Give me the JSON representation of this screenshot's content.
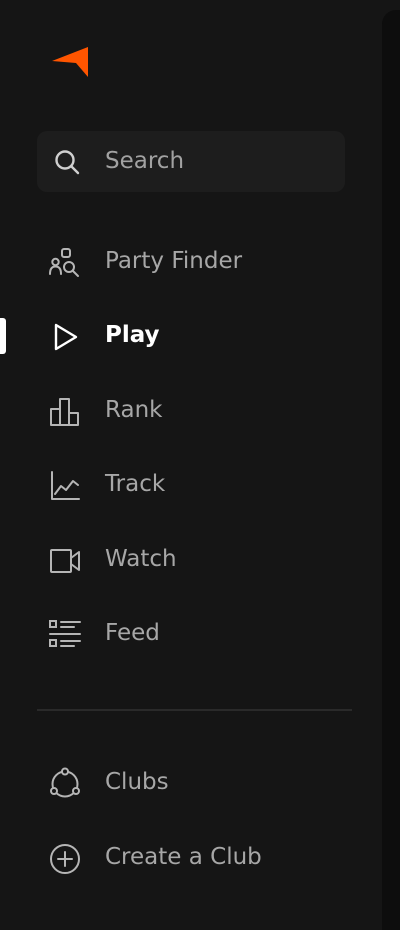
{
  "sidebar": {
    "search": {
      "placeholder": "Search",
      "icon": "search-icon"
    },
    "nav": [
      {
        "label": "Party Finder",
        "icon": "party-finder-icon",
        "active": false
      },
      {
        "label": "Play",
        "icon": "play-icon",
        "active": true
      },
      {
        "label": "Rank",
        "icon": "rank-icon",
        "active": false
      },
      {
        "label": "Track",
        "icon": "track-icon",
        "active": false
      },
      {
        "label": "Watch",
        "icon": "watch-icon",
        "active": false
      },
      {
        "label": "Feed",
        "icon": "feed-icon",
        "active": false
      }
    ],
    "clubs": [
      {
        "label": "Clubs",
        "icon": "clubs-icon"
      },
      {
        "label": "Create a Club",
        "icon": "add-circle-icon"
      }
    ]
  },
  "colors": {
    "background": "#151515",
    "accent": "#ff5500",
    "text": "#a7a7a7",
    "active_text": "#ffffff"
  }
}
